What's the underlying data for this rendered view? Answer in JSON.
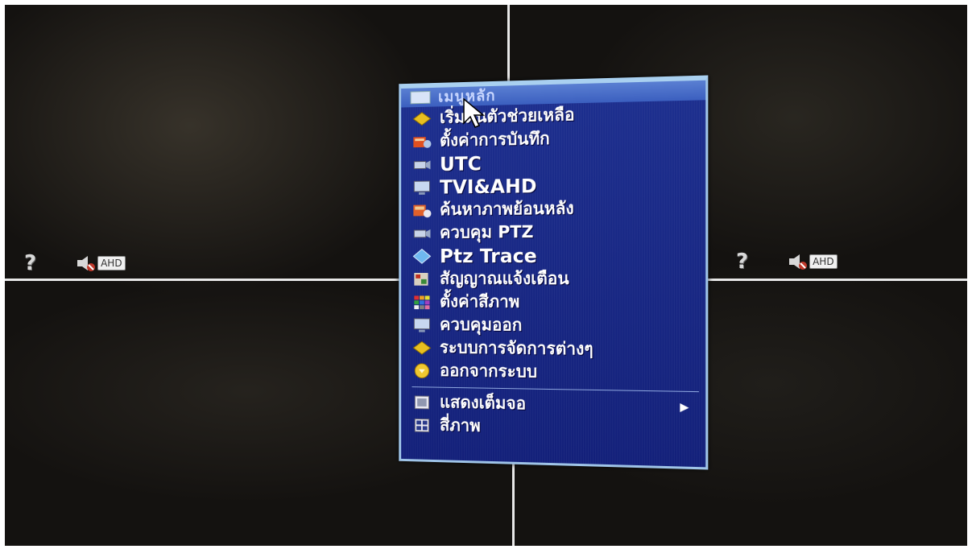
{
  "menu": {
    "title": "เมนูหลัก",
    "items": [
      {
        "label": "เริ่มต้นตัวช่วยเหลือ",
        "icon": "wizard-icon"
      },
      {
        "label": "ตั้งค่าการบันทึก",
        "icon": "record-settings-icon"
      },
      {
        "label": "UTC",
        "icon": "camera-icon"
      },
      {
        "label": "TVI&AHD",
        "icon": "monitor-icon"
      },
      {
        "label": "ค้นหาภาพย้อนหลัง",
        "icon": "playback-search-icon"
      },
      {
        "label": "ควบคุม PTZ",
        "icon": "ptz-camera-icon"
      },
      {
        "label": "Ptz Trace",
        "icon": "diamond-icon"
      },
      {
        "label": "สัญญาณแจ้งเตือน",
        "icon": "alarm-icon"
      },
      {
        "label": "ตั้งค่าสีภาพ",
        "icon": "color-grid-icon"
      },
      {
        "label": "ควบคุมออก",
        "icon": "output-monitor-icon"
      },
      {
        "label": "ระบบการจัดการต่างๆ",
        "icon": "system-management-icon"
      },
      {
        "label": "ออกจากระบบ",
        "icon": "logout-icon"
      }
    ],
    "view_items": [
      {
        "label": "แสดงเต็มจอ",
        "icon": "fullscreen-icon",
        "arrow": "▶"
      },
      {
        "label": "สี่ภาพ",
        "icon": "quad-view-icon"
      }
    ]
  },
  "channels": [
    {
      "help": "?",
      "badge": "AHD"
    },
    {
      "help": "?",
      "badge": "AHD"
    }
  ]
}
